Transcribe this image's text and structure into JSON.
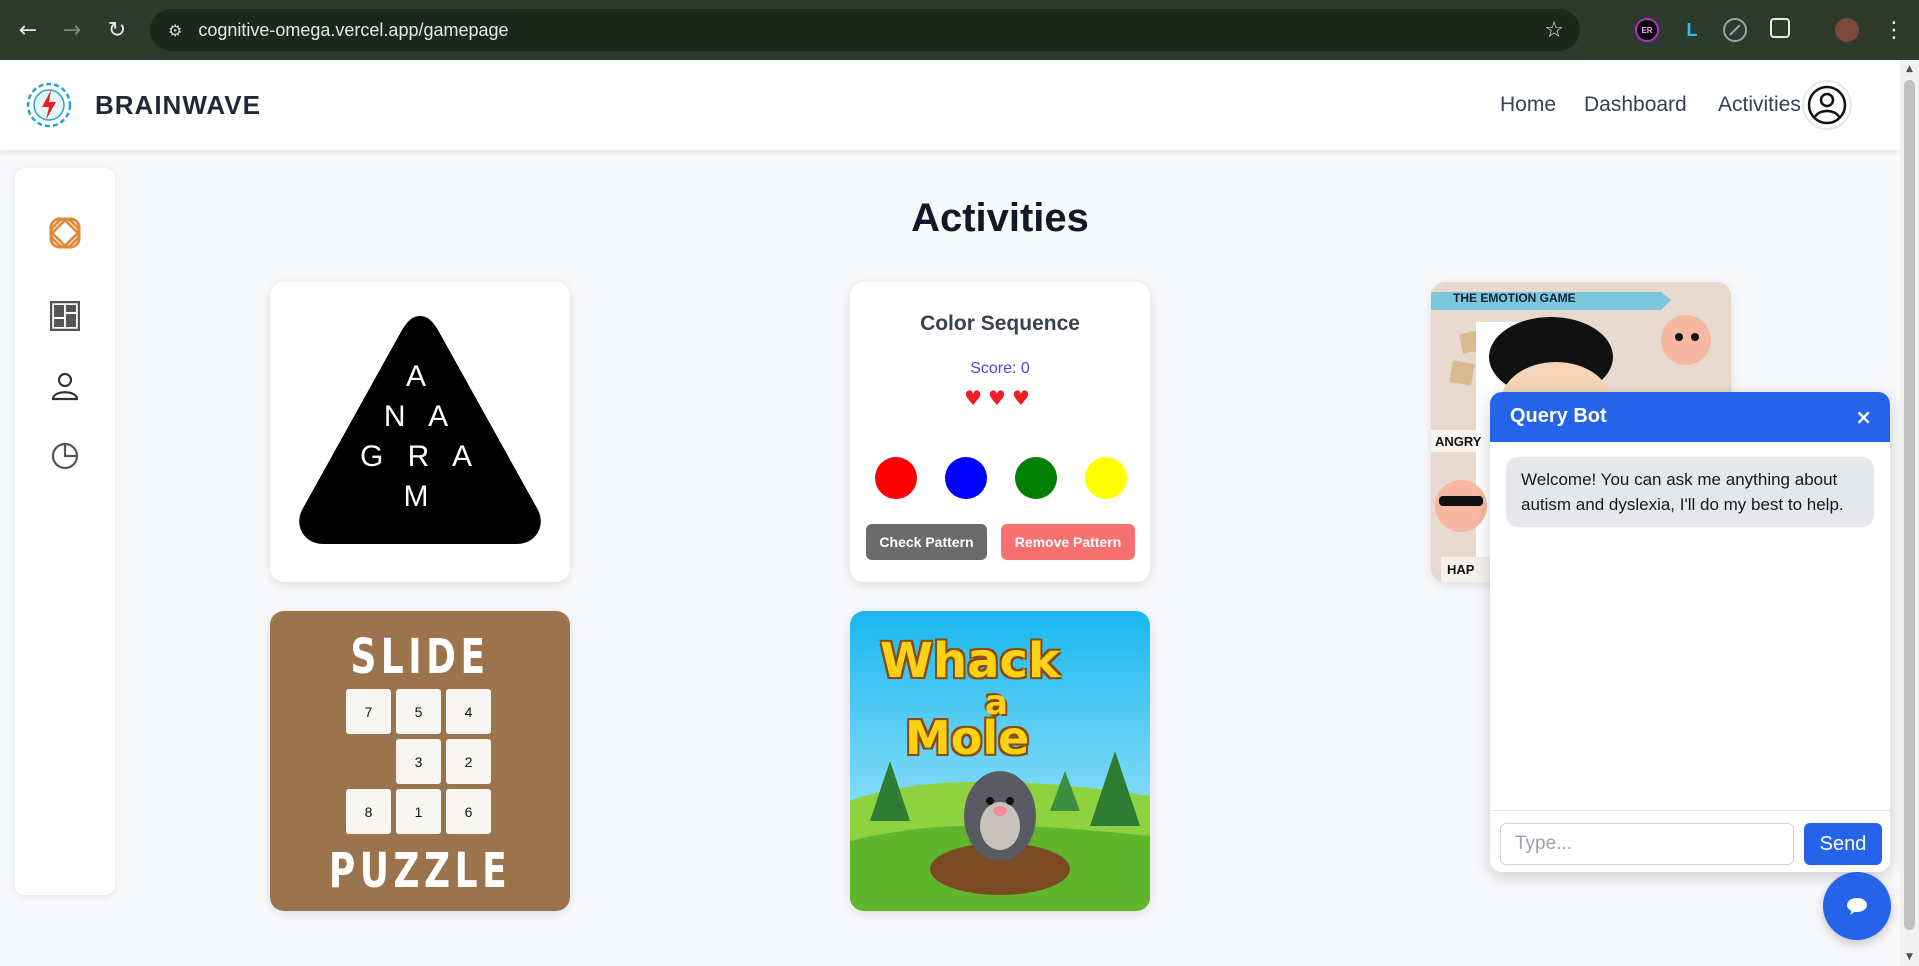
{
  "browser": {
    "url": "cognitive-omega.vercel.app/gamepage",
    "extensions": [
      "ER",
      "L"
    ]
  },
  "header": {
    "brand": "BRAINWAVE",
    "nav": [
      "Home",
      "Dashboard",
      "Activities"
    ]
  },
  "sidebar": {
    "icons": [
      "brand-knot-icon",
      "dashboard-icon",
      "user-icon",
      "pie-chart-icon"
    ]
  },
  "main": {
    "title": "Activities",
    "anagram": {
      "letters": [
        "A",
        "N A",
        "G R A",
        "M"
      ]
    },
    "color_sequence": {
      "title": "Color Sequence",
      "score_text": "Score: 0",
      "hearts": "♥♥♥",
      "colors": [
        "#ff0000",
        "#0000ff",
        "#008000",
        "#ffff00"
      ],
      "check_label": "Check Pattern",
      "remove_label": "Remove Pattern"
    },
    "emotion_game": {
      "banner": "THE EMOTION GAME",
      "label_angry": "ANGRY",
      "label_happy": "HAP"
    },
    "slide_puzzle": {
      "top": "SLIDE",
      "bottom": "PUZZLE",
      "tiles": [
        "7",
        "5",
        "4",
        "",
        "3",
        "2",
        "8",
        "1",
        "6"
      ]
    },
    "whack_a_mole": {
      "line1": "Whack",
      "line2": "a",
      "line3": "Mole"
    }
  },
  "chat": {
    "title": "Query Bot",
    "close": "×",
    "welcome": "Welcome! You can ask me anything about autism and dyslexia, I'll do my best to help.",
    "input_placeholder": "Type...",
    "send_label": "Send"
  },
  "colors": {
    "accent": "#2563eb",
    "header_bg": "#ffffff",
    "page_bg": "#f7f8fa",
    "check_btn": "#6b6b6b",
    "remove_btn": "#f87171",
    "slide_bg": "#9b744e"
  }
}
